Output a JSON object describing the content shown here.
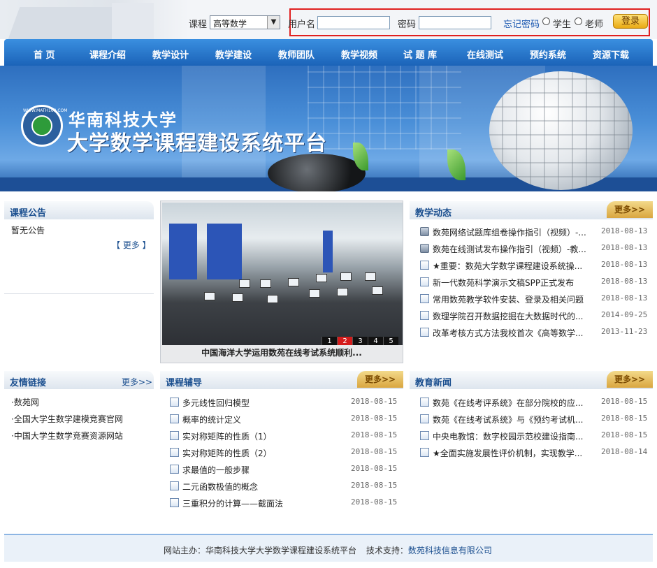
{
  "login": {
    "course_label": "课程",
    "course_selected": "高等数学",
    "username_label": "用户名",
    "username_value": "",
    "password_label": "密码",
    "password_value": "",
    "forgot_label": "忘记密码",
    "role_student": "学生",
    "role_teacher": "老师",
    "login_button": "登录"
  },
  "nav": [
    "首 页",
    "课程介绍",
    "教学设计",
    "教学建设",
    "教师团队",
    "教学视频",
    "试 题 库",
    "在线测试",
    "预约系统",
    "资源下载"
  ],
  "banner": {
    "university": "华南科技大学",
    "platform": "大学数学课程建设系统平台",
    "logo_text": "WWW.MATH168.COM"
  },
  "announcements": {
    "title": "课程公告",
    "content": "暂无公告",
    "more": "【 更多 】"
  },
  "slider": {
    "caption": "中国海洋大学运用数苑在线考试系统顺利...",
    "pages": [
      "1",
      "2",
      "3",
      "4",
      "5"
    ],
    "active_page": "2"
  },
  "teaching_news": {
    "title": "教学动态",
    "more": "更多>>",
    "items": [
      {
        "title": "数苑网络试题库组卷操作指引（视频）-...",
        "date": "2018-08-13",
        "icon": "video-icon"
      },
      {
        "title": "数苑在线测试发布操作指引（视频）-教...",
        "date": "2018-08-13",
        "icon": "video-icon"
      },
      {
        "title": "★重要：数苑大学数学课程建设系统操...",
        "date": "2018-08-13",
        "icon": "page-icon"
      },
      {
        "title": "新一代数苑科学演示文稿SPP正式发布",
        "date": "2018-08-13",
        "icon": "page-icon"
      },
      {
        "title": "常用数苑教学软件安装、登录及相关问题",
        "date": "2018-08-13",
        "icon": "page-icon"
      },
      {
        "title": "数理学院召开数据挖掘在大数据时代的...",
        "date": "2014-09-25",
        "icon": "page-icon"
      },
      {
        "title": "改革考核方式方法我校首次《高等数学...",
        "date": "2013-11-23",
        "icon": "page-icon"
      }
    ]
  },
  "links": {
    "title": "友情链接",
    "more": "更多>>",
    "items": [
      "·数苑网",
      "·全国大学生数学建模竞赛官网",
      "·中国大学生数学竞赛资源网站"
    ]
  },
  "tutoring": {
    "title": "课程辅导",
    "more": "更多>>",
    "items": [
      {
        "title": "多元线性回归模型",
        "date": "2018-08-15"
      },
      {
        "title": "概率的统计定义",
        "date": "2018-08-15"
      },
      {
        "title": "实对称矩阵的性质（1）",
        "date": "2018-08-15"
      },
      {
        "title": "实对称矩阵的性质（2）",
        "date": "2018-08-15"
      },
      {
        "title": "求最值的一般步骤",
        "date": "2018-08-15"
      },
      {
        "title": "二元函数极值的概念",
        "date": "2018-08-15"
      },
      {
        "title": "三重积分的计算——截面法",
        "date": "2018-08-15"
      }
    ]
  },
  "edu_news": {
    "title": "教育新闻",
    "more": "更多>>",
    "items": [
      {
        "title": "数苑《在线考评系统》在部分院校的应...",
        "date": "2018-08-15"
      },
      {
        "title": "数苑《在线考试系统》与《预约考试机...",
        "date": "2018-08-15"
      },
      {
        "title": "中央电教馆：数字校园示范校建设指南...",
        "date": "2018-08-15"
      },
      {
        "title": "★全面实施发展性评价机制，实现教学...",
        "date": "2018-08-14"
      }
    ]
  },
  "footer": {
    "host": "网站主办：华南科技大学大学数学课程建设系统平台",
    "support_label": "技术支持：",
    "support_name": "数苑科技信息有限公司"
  },
  "colors": {
    "nav_blue": "#1b63b8",
    "title_blue": "#1b4f8f",
    "more_gold": "#d9a640",
    "highlight_red": "#e02020"
  }
}
